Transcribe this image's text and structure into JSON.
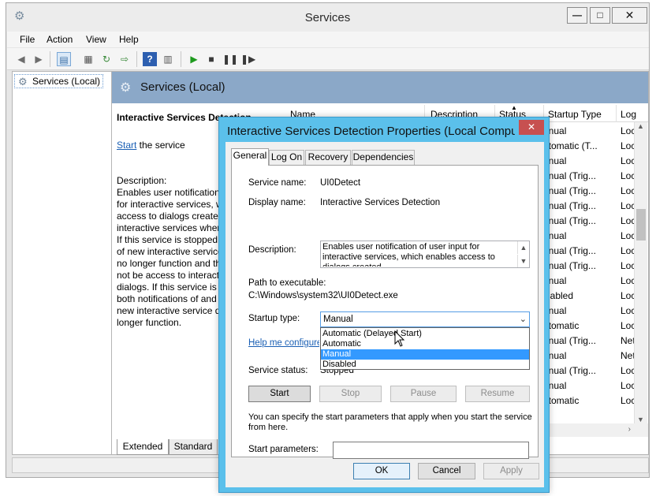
{
  "window": {
    "title": "Services",
    "minimize": "—",
    "maximize": "□",
    "close": "✕"
  },
  "menu": [
    "File",
    "Action",
    "View",
    "Help"
  ],
  "tree": {
    "root_label": "Services (Local)"
  },
  "content": {
    "header_title": "Services (Local)",
    "detail_title": "Interactive Services Detection",
    "start_link": "Start",
    "start_suffix": " the service",
    "description_label": "Description:",
    "description_text": "Enables user notification\nfor interactive services, w\naccess to dialogs created\ninteractive services when\nIf this service is stopped,\nof new interactive service\nno longer function and th\nnot be access to interacti\ndialogs. If this service is d\nboth notifications of and\nnew interactive service di\nlonger function.",
    "tabs": {
      "extended": "Extended",
      "standard": "Standard"
    }
  },
  "list": {
    "columns": [
      "Name",
      "Description",
      "Status",
      "Startup Type",
      "Log"
    ],
    "rows": [
      {
        "startup": "anual",
        "log": "Loc"
      },
      {
        "startup": "utomatic (T...",
        "log": "Loc"
      },
      {
        "startup": "anual",
        "log": "Loc"
      },
      {
        "startup": "anual (Trig...",
        "log": "Loc"
      },
      {
        "startup": "anual (Trig...",
        "log": "Loc"
      },
      {
        "startup": "anual (Trig...",
        "log": "Loc"
      },
      {
        "startup": "anual (Trig...",
        "log": "Loc"
      },
      {
        "startup": "anual",
        "log": "Loc"
      },
      {
        "startup": "anual (Trig...",
        "log": "Loc"
      },
      {
        "startup": "anual (Trig...",
        "log": "Loc"
      },
      {
        "startup": "anual",
        "log": "Loc"
      },
      {
        "startup": "isabled",
        "log": "Loc"
      },
      {
        "startup": "anual",
        "log": "Loc"
      },
      {
        "startup": "utomatic",
        "log": "Loc"
      },
      {
        "startup": "anual (Trig...",
        "log": "Net"
      },
      {
        "startup": "anual",
        "log": "Net"
      },
      {
        "startup": "anual (Trig...",
        "log": "Loc"
      },
      {
        "startup": "anual",
        "log": "Loc"
      },
      {
        "startup": "utomatic",
        "log": "Loc"
      }
    ]
  },
  "dialog": {
    "title": "Interactive Services Detection Properties (Local Compu...",
    "close": "✕",
    "tabs": [
      "General",
      "Log On",
      "Recovery",
      "Dependencies"
    ],
    "service_name_label": "Service name:",
    "service_name": "UI0Detect",
    "display_name_label": "Display name:",
    "display_name": "Interactive Services Detection",
    "description_label": "Description:",
    "description": "Enables user notification of user input for interactive services, which enables access to dialogs created",
    "path_label": "Path to executable:",
    "path": "C:\\Windows\\system32\\UI0Detect.exe",
    "startup_type_label": "Startup type:",
    "startup_type_value": "Manual",
    "startup_options": [
      "Automatic (Delayed Start)",
      "Automatic",
      "Manual",
      "Disabled"
    ],
    "help_link": "Help me configure s",
    "service_status_label": "Service status:",
    "service_status": "Stopped",
    "buttons": {
      "start": "Start",
      "stop": "Stop",
      "pause": "Pause",
      "resume": "Resume"
    },
    "params_hint": "You can specify the start parameters that apply when you start the service from here.",
    "params_label": "Start parameters:",
    "footer": {
      "ok": "OK",
      "cancel": "Cancel",
      "apply": "Apply"
    }
  }
}
